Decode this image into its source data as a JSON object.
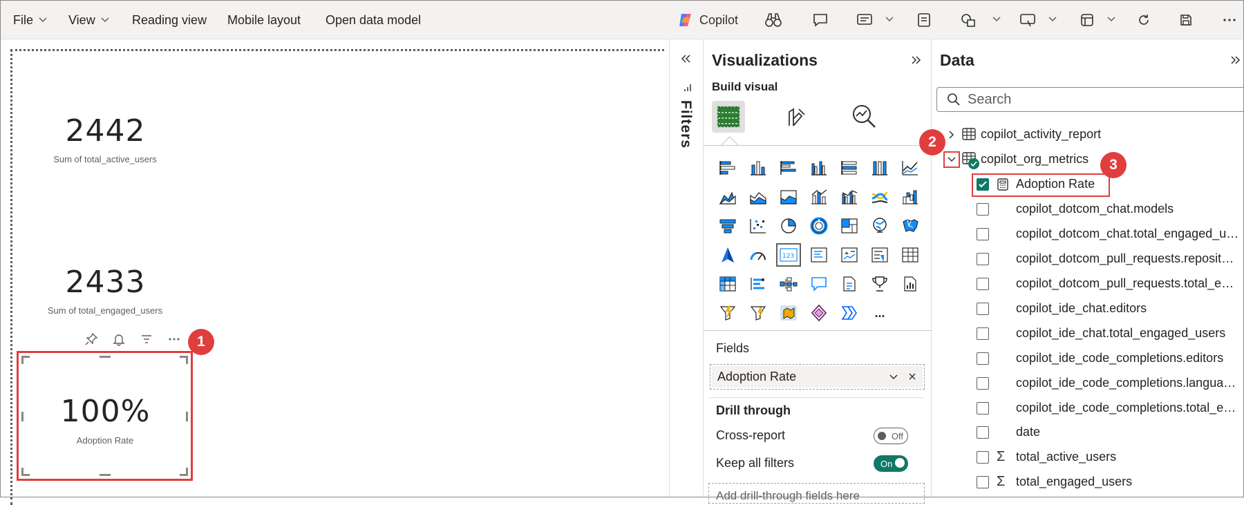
{
  "menu": {
    "file": "File",
    "view": "View",
    "reading_view": "Reading view",
    "mobile_layout": "Mobile layout",
    "open_data_model": "Open data model",
    "copilot": "Copilot"
  },
  "canvas": {
    "cards": [
      {
        "value": "2442",
        "label": "Sum of total_active_users"
      },
      {
        "value": "2433",
        "label": "Sum of total_engaged_users"
      },
      {
        "value": "100%",
        "label": "Adoption Rate"
      }
    ]
  },
  "filters": {
    "label": "Filters"
  },
  "visualizations": {
    "title": "Visualizations",
    "build_visual": "Build visual",
    "more": "...",
    "fields_label": "Fields",
    "field_value": "Adoption Rate",
    "drill_through": "Drill through",
    "cross_report": "Cross-report",
    "cross_report_state": "Off",
    "keep_all_filters": "Keep all filters",
    "keep_all_filters_state": "On",
    "add_drill_placeholder": "Add drill-through fields here"
  },
  "data": {
    "title": "Data",
    "search_placeholder": "Search",
    "tables": [
      {
        "name": "copilot_activity_report",
        "expanded": false
      },
      {
        "name": "copilot_org_metrics",
        "expanded": true
      }
    ],
    "fields": [
      {
        "name": "Adoption Rate",
        "checked": true,
        "icon": "measure-calculator-icon"
      },
      {
        "name": "copilot_dotcom_chat.models",
        "checked": false
      },
      {
        "name": "copilot_dotcom_chat.total_engaged_us...",
        "checked": false
      },
      {
        "name": "copilot_dotcom_pull_requests.repositori...",
        "checked": false
      },
      {
        "name": "copilot_dotcom_pull_requests.total_eng...",
        "checked": false
      },
      {
        "name": "copilot_ide_chat.editors",
        "checked": false
      },
      {
        "name": "copilot_ide_chat.total_engaged_users",
        "checked": false
      },
      {
        "name": "copilot_ide_code_completions.editors",
        "checked": false
      },
      {
        "name": "copilot_ide_code_completions.languages",
        "checked": false
      },
      {
        "name": "copilot_ide_code_completions.total_eng...",
        "checked": false
      },
      {
        "name": "date",
        "checked": false
      },
      {
        "name": "total_active_users",
        "checked": false,
        "icon": "sigma-icon"
      },
      {
        "name": "total_engaged_users",
        "checked": false,
        "icon": "sigma-icon"
      }
    ]
  },
  "annotations": [
    "1",
    "2",
    "3"
  ],
  "colors": {
    "accent_teal": "#117865",
    "annotation_red": "#e03e3e",
    "chart_blue": "#118dff",
    "toolbar_bg": "#f3f2f1"
  }
}
